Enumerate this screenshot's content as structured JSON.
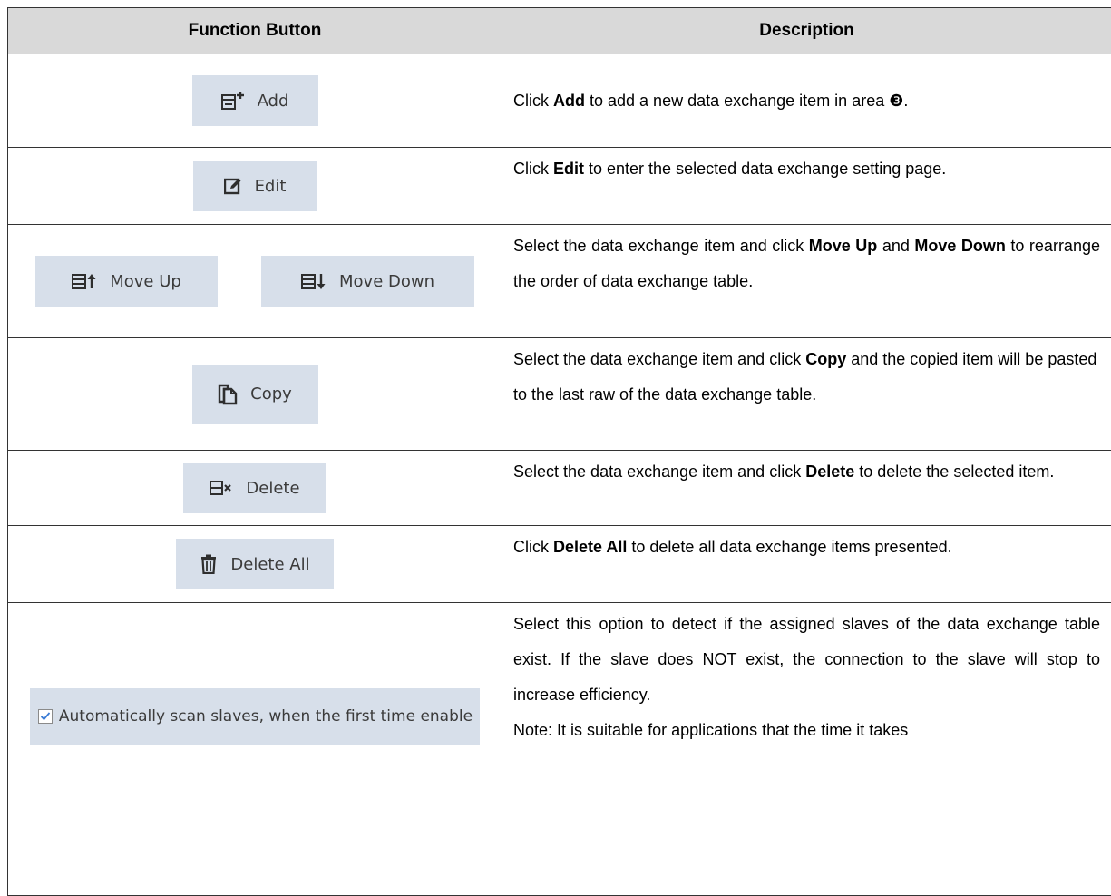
{
  "header": {
    "col1": "Function Button",
    "col2": "Description"
  },
  "rows": {
    "add": {
      "button": "Add",
      "d1": "Click ",
      "b1": "Add",
      "d2": " to add a new data exchange item in area ❸."
    },
    "edit": {
      "button": "Edit",
      "d1": "Click ",
      "b1": "Edit",
      "d2": " to enter the selected data exchange setting page."
    },
    "move": {
      "button_up": "Move Up",
      "button_down": "Move Down",
      "d1": "Select the data exchange item and click ",
      "b1": "Move Up",
      "d2": " and ",
      "b2": "Move Down",
      "d3": " to rearrange the order of data exchange table."
    },
    "copy": {
      "button": "Copy",
      "d1": "Select the data exchange item and click ",
      "b1": "Copy",
      "d2": " and the copied item will be pasted to the last raw of the data exchange table."
    },
    "delete": {
      "button": "Delete",
      "d1": "Select the data exchange item and click ",
      "b1": "Delete",
      "d2": " to delete the selected item."
    },
    "delete_all": {
      "button": "Delete All",
      "d1": "Click ",
      "b1": "Delete All",
      "d2": " to delete all data exchange items presented."
    },
    "auto_scan": {
      "checkbox_label": "Automatically scan slaves, when the first time enable",
      "checked": true,
      "d1": "Select this option to detect if the assigned slaves of the data exchange table exist. If the slave does NOT exist, the connection to the slave will stop to increase efficiency.",
      "d2": "Note: It is suitable for applications that the time it takes"
    }
  },
  "colors": {
    "header_bg": "#d9d9d9",
    "button_bg": "#d7dfea",
    "border": "#333333"
  }
}
